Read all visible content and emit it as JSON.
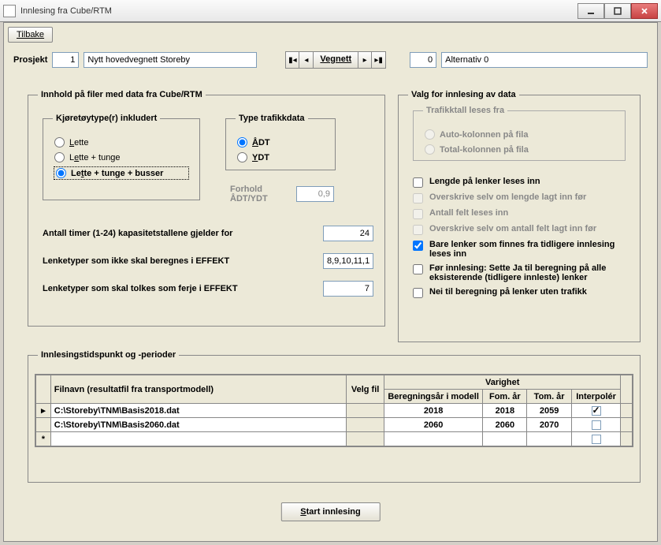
{
  "window": {
    "title": "Innlesing fra Cube/RTM"
  },
  "toolbar": {
    "tilbake": "Tilbake"
  },
  "project": {
    "label": "Prosjekt",
    "id": "1",
    "name": "Nytt hovedvegnett Storeby",
    "nav_label": "Vegnett",
    "alt_id": "0",
    "alt_name": "Alternativ 0"
  },
  "fs1": {
    "legend": "Innhold på filer med data fra Cube/RTM",
    "vehicle_legend": "Kjøretøytype(r) inkludert",
    "veh_opts": [
      "Lette",
      "Lette + tunge",
      "Lette + tunge + busser"
    ],
    "traf_legend": "Type trafikkdata",
    "traf_opts": [
      "ÅDT",
      "YDT"
    ],
    "forhold_label": "Forhold ÅDT/YDT",
    "forhold_value": "0,9",
    "hours_label": "Antall timer (1-24) kapasitetstallene gjelder for",
    "hours_value": "24",
    "excl_label": "Lenketyper som ikke skal beregnes i EFFEKT",
    "excl_value": "8,9,10,11,1",
    "ferry_label": "Lenketyper som skal tolkes som ferje i EFFEKT",
    "ferry_value": "7"
  },
  "fs2": {
    "legend": "Valg for innlesing av data",
    "src_legend": "Trafikktall leses fra",
    "src_opts": [
      "Auto-kolonnen på fila",
      "Total-kolonnen på fila"
    ],
    "chk": [
      "Lengde på lenker leses inn",
      "Overskrive selv om lengde lagt inn før",
      "Antall felt leses inn",
      "Overskrive selv om antall felt lagt inn før",
      "Bare lenker som finnes fra tidligere innlesing leses inn",
      "Før innlesing: Sette Ja til beregning på alle eksisterende (tidligere innleste) lenker",
      "Nei til beregning på lenker uten trafikk"
    ]
  },
  "fs3": {
    "legend": "Innlesingstidspunkt og -perioder",
    "cols": {
      "filnavn": "Filnavn (resultatfil fra transportmodell)",
      "velg": "Velg fil",
      "varighet": "Varighet",
      "bereg": "Beregningsår i modell",
      "fom": "Fom. år",
      "tom": "Tom. år",
      "interp": "Interpolér"
    },
    "rows": [
      {
        "fil": "C:\\Storeby\\TNM\\Basis2018.dat",
        "bereg": "2018",
        "fom": "2018",
        "tom": "2059",
        "interp": true
      },
      {
        "fil": "C:\\Storeby\\TNM\\Basis2060.dat",
        "bereg": "2060",
        "fom": "2060",
        "tom": "2070",
        "interp": false
      }
    ]
  },
  "start": "Start innlesing"
}
